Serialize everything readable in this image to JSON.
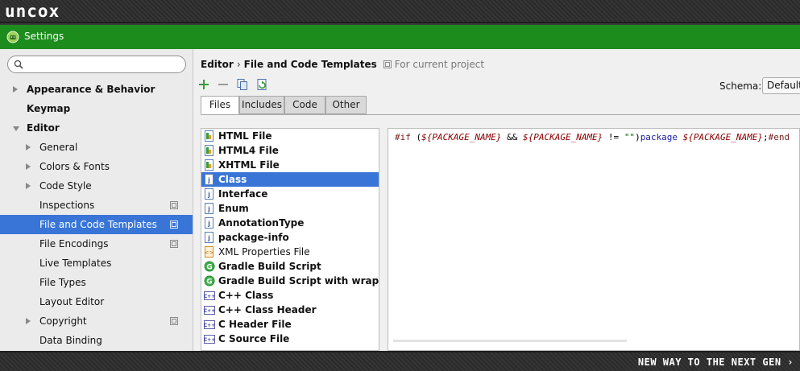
{
  "brand": {
    "logo_text": "uncox",
    "slogan": "NEW WAY TO THE NEXT GEN ›"
  },
  "window": {
    "title": "Settings",
    "app_icon": "android-icon",
    "accent": "#1c8c1c"
  },
  "sidebar": {
    "search": {
      "value": "",
      "placeholder": ""
    },
    "items": [
      {
        "label": "Appearance & Behavior",
        "bold": true,
        "indent": 0,
        "arrow": "right",
        "project": false,
        "selected": false
      },
      {
        "label": "Keymap",
        "bold": true,
        "indent": 0,
        "arrow": "",
        "project": false,
        "selected": false
      },
      {
        "label": "Editor",
        "bold": true,
        "indent": 0,
        "arrow": "down",
        "project": false,
        "selected": false
      },
      {
        "label": "General",
        "bold": false,
        "indent": 1,
        "arrow": "right",
        "project": false,
        "selected": false
      },
      {
        "label": "Colors & Fonts",
        "bold": false,
        "indent": 1,
        "arrow": "right",
        "project": false,
        "selected": false
      },
      {
        "label": "Code Style",
        "bold": false,
        "indent": 1,
        "arrow": "right",
        "project": false,
        "selected": false
      },
      {
        "label": "Inspections",
        "bold": false,
        "indent": 1,
        "arrow": "",
        "project": true,
        "selected": false
      },
      {
        "label": "File and Code Templates",
        "bold": false,
        "indent": 1,
        "arrow": "",
        "project": true,
        "selected": true
      },
      {
        "label": "File Encodings",
        "bold": false,
        "indent": 1,
        "arrow": "",
        "project": true,
        "selected": false
      },
      {
        "label": "Live Templates",
        "bold": false,
        "indent": 1,
        "arrow": "",
        "project": false,
        "selected": false
      },
      {
        "label": "File Types",
        "bold": false,
        "indent": 1,
        "arrow": "",
        "project": false,
        "selected": false
      },
      {
        "label": "Layout Editor",
        "bold": false,
        "indent": 1,
        "arrow": "",
        "project": false,
        "selected": false
      },
      {
        "label": "Copyright",
        "bold": false,
        "indent": 1,
        "arrow": "right",
        "project": true,
        "selected": false
      },
      {
        "label": "Data Binding",
        "bold": false,
        "indent": 1,
        "arrow": "",
        "project": false,
        "selected": false
      }
    ]
  },
  "content": {
    "breadcrumb": {
      "parent": "Editor",
      "separator": "›",
      "current": "File and Code Templates",
      "hint": "For current project"
    },
    "toolbar": [
      "add-icon",
      "remove-icon",
      "copy-icon",
      "reset-icon"
    ],
    "schema": {
      "label": "Schema:",
      "value": "Default"
    },
    "tabs": [
      {
        "label": "Files",
        "active": true
      },
      {
        "label": "Includes",
        "active": false
      },
      {
        "label": "Code",
        "active": false
      },
      {
        "label": "Other",
        "active": false
      }
    ],
    "files": [
      {
        "label": "HTML File",
        "icon": "html-file-icon",
        "bold": true,
        "selected": false
      },
      {
        "label": "HTML4 File",
        "icon": "html-file-icon",
        "bold": true,
        "selected": false
      },
      {
        "label": "XHTML File",
        "icon": "html-file-icon",
        "bold": true,
        "selected": false
      },
      {
        "label": "Class",
        "icon": "java-file-icon",
        "bold": true,
        "selected": true
      },
      {
        "label": "Interface",
        "icon": "java-file-icon",
        "bold": true,
        "selected": false
      },
      {
        "label": "Enum",
        "icon": "java-file-icon",
        "bold": true,
        "selected": false
      },
      {
        "label": "AnnotationType",
        "icon": "java-file-icon",
        "bold": true,
        "selected": false
      },
      {
        "label": "package-info",
        "icon": "java-file-icon",
        "bold": true,
        "selected": false
      },
      {
        "label": "XML Properties File",
        "icon": "xml-file-icon",
        "bold": false,
        "selected": false
      },
      {
        "label": "Gradle Build Script",
        "icon": "gradle-icon",
        "bold": true,
        "selected": false
      },
      {
        "label": "Gradle Build Script with wrapper",
        "icon": "gradle-icon",
        "bold": true,
        "selected": false
      },
      {
        "label": "C++ Class",
        "icon": "cpp-file-icon",
        "bold": true,
        "selected": false
      },
      {
        "label": "C++ Class Header",
        "icon": "cpp-file-icon",
        "bold": true,
        "selected": false
      },
      {
        "label": "C Header File",
        "icon": "cpp-file-icon",
        "bold": true,
        "selected": false
      },
      {
        "label": "C Source File",
        "icon": "cpp-file-icon",
        "bold": true,
        "selected": false
      }
    ],
    "editor": {
      "code_parts": [
        {
          "text": "#if",
          "cls": "kw"
        },
        {
          "text": " (",
          "cls": ""
        },
        {
          "text": "${PACKAGE_NAME}",
          "cls": "var"
        },
        {
          "text": " && ",
          "cls": ""
        },
        {
          "text": "${PACKAGE_NAME}",
          "cls": "var"
        },
        {
          "text": " != ",
          "cls": ""
        },
        {
          "text": "\"\"",
          "cls": "str"
        },
        {
          "text": ")",
          "cls": ""
        },
        {
          "text": "package",
          "cls": "pk"
        },
        {
          "text": " ",
          "cls": ""
        },
        {
          "text": "${PACKAGE_NAME}",
          "cls": "var"
        },
        {
          "text": ";",
          "cls": ""
        },
        {
          "text": "#end",
          "cls": "kw"
        }
      ]
    }
  }
}
